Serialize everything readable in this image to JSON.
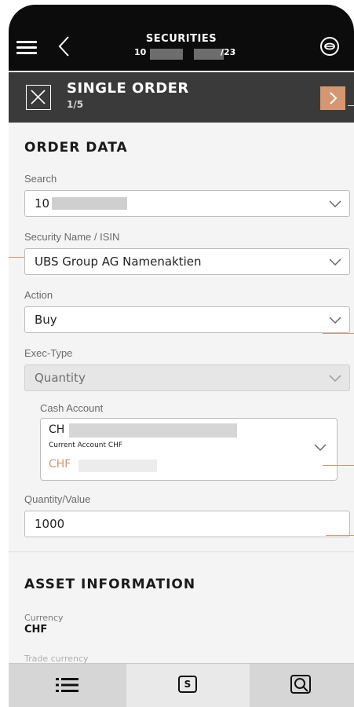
{
  "header": {
    "title": "SECURITIES",
    "sub_prefix": "10",
    "sub_suffix": "/23"
  },
  "order_bar": {
    "title": "SINGLE ORDER",
    "step": "1/5"
  },
  "order_data": {
    "section_title": "ORDER DATA",
    "search": {
      "label": "Search",
      "value": "10"
    },
    "security": {
      "label": "Security Name / ISIN",
      "value": "UBS Group AG Namenaktien"
    },
    "action": {
      "label": "Action",
      "value": "Buy"
    },
    "exec_type": {
      "label": "Exec-Type",
      "value": "Quantity"
    },
    "cash_account": {
      "label": "Cash Account",
      "iban_prefix": "CH",
      "account_name": "Current Account CHF",
      "balance_prefix": "CHF"
    },
    "quantity": {
      "label": "Quantity/Value",
      "value": "1000"
    }
  },
  "asset_info": {
    "section_title": "ASSET INFORMATION",
    "currency_label": "Currency",
    "currency_value": "CHF",
    "trade_currency_label": "Trade currency"
  },
  "colors": {
    "accent": "#d49772",
    "header_bg": "#0c0c0c",
    "order_bar_bg": "#3a3a3a"
  },
  "tabs": [
    {
      "icon": "list-icon"
    },
    {
      "icon": "securities-icon",
      "glyph": "S"
    },
    {
      "icon": "search-icon"
    }
  ]
}
